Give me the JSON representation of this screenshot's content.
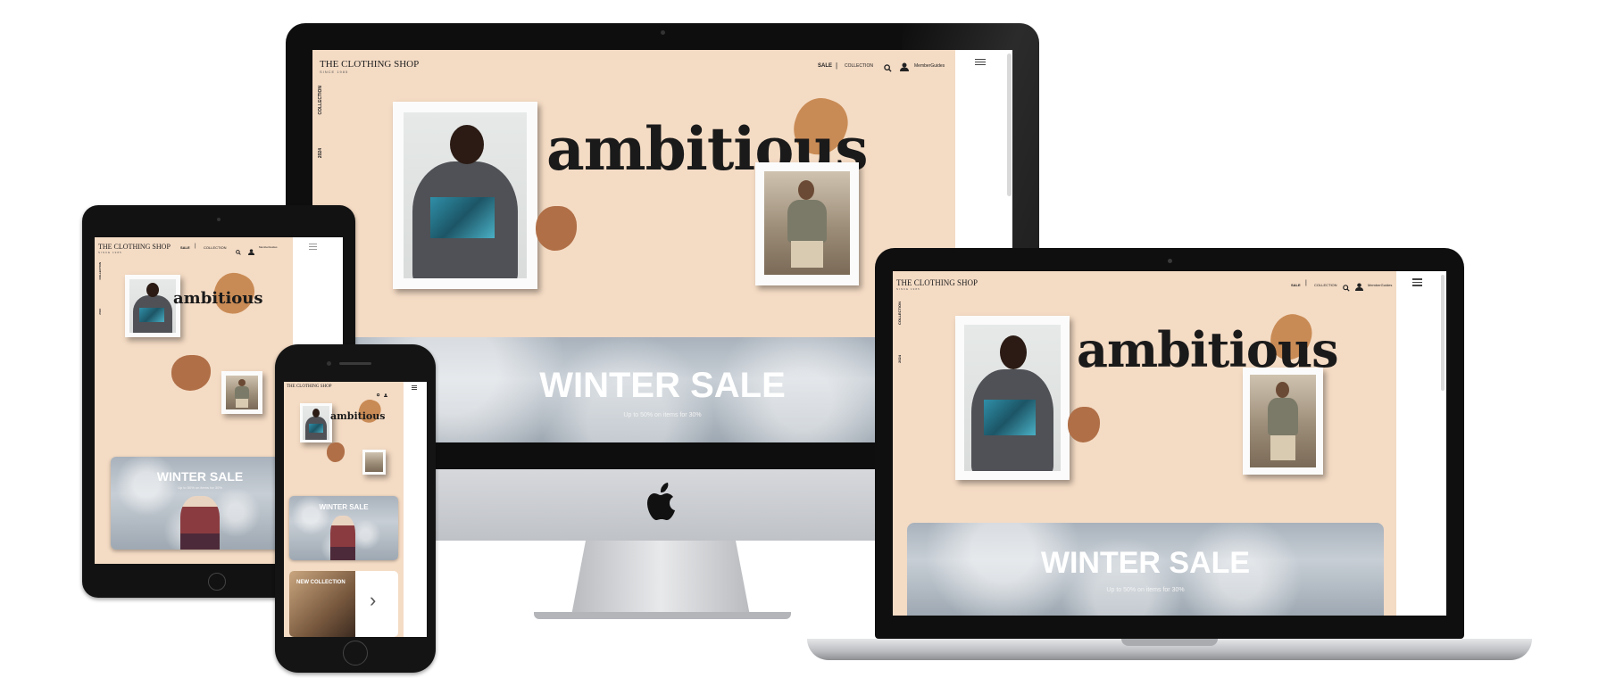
{
  "site": {
    "logo_title": "THE CLOTHING SHOP",
    "logo_sub": "SINCE 1985",
    "nav_sale": "SALE",
    "nav_separator": "|",
    "nav_collection": "COLLECTION",
    "nav_account": "MemberGuides",
    "vertical_collection": "COLLECTION",
    "vertical_year": "2024",
    "hero_word": "ambitious",
    "winter_title": "WINTER SALE",
    "winter_sub": "Up to 50% on items for 30%",
    "new_collection": "NEW COLLECTION",
    "next_arrow": "›"
  },
  "colors": {
    "peach_background": "#f4dbc4",
    "blob_light": "#d09a63",
    "blob_dark": "#b06f47",
    "device_black": "#111111",
    "imac_silver": "#c9cbcf"
  },
  "icons": [
    "search-icon",
    "user-icon",
    "hamburger-menu-icon",
    "apple-logo-icon",
    "chevron-right-icon"
  ]
}
